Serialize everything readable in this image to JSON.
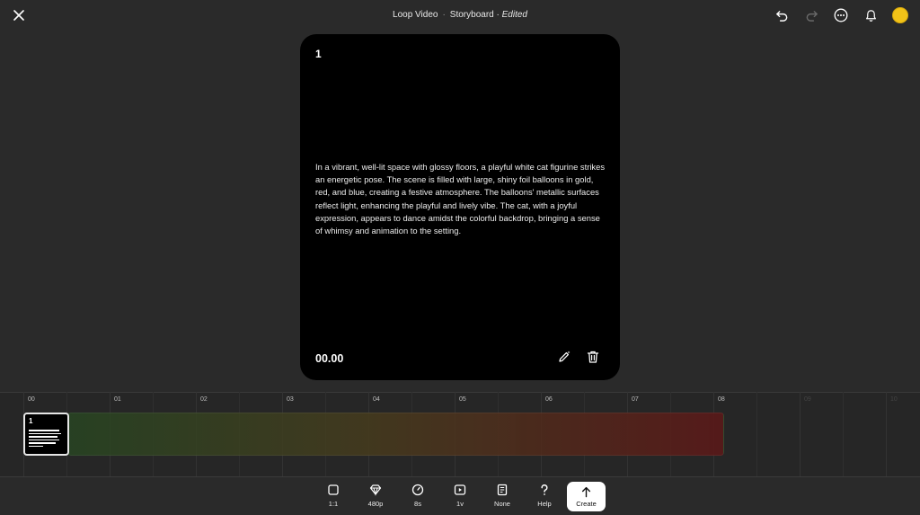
{
  "header": {
    "project": "Loop Video",
    "separator": "·",
    "section": "Storyboard",
    "status_sep": " · ",
    "status": "Edited"
  },
  "icons": {
    "close": "close-icon",
    "undo": "undo-icon",
    "redo": "redo-icon",
    "more": "more-icon",
    "bell": "bell-icon",
    "avatar_color": "#f2c318"
  },
  "scene": {
    "number": "1",
    "description": "In a vibrant, well-lit space with glossy floors, a playful white cat figurine strikes an energetic pose. The scene is filled with large, shiny foil balloons in gold, red, and blue, creating a festive atmosphere. The balloons' metallic surfaces reflect light, enhancing the playful and lively vibe. The cat, with a joyful expression, appears to dance amidst the colorful backdrop, bringing a sense of whimsy and animation to the setting.",
    "time": "00.00"
  },
  "timeline": {
    "ticks": [
      "00",
      "01",
      "02",
      "03",
      "04",
      "05",
      "06",
      "07",
      "08",
      "09",
      "10"
    ],
    "clip_number": "1"
  },
  "toolbar": {
    "aspect_label": "1:1",
    "quality_label": "480p",
    "duration_label": "8s",
    "version_label": "1v",
    "style_label": "None",
    "help_label": "Help",
    "create_label": "Create"
  }
}
